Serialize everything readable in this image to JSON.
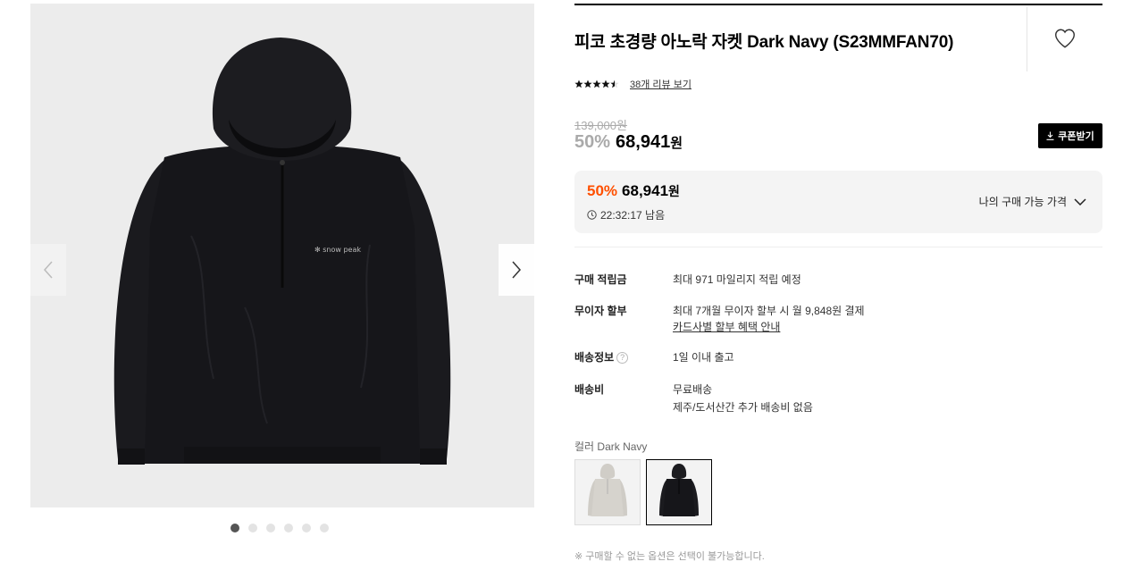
{
  "product": {
    "title": "피코 초경량 아노락 자켓 Dark Navy (S23MMFAN70)",
    "review_link": "38개 리뷰 보기",
    "rating_stars": 4.5
  },
  "pricing": {
    "original_price": "139,000원",
    "discount_rate": "50%",
    "sale_price": "68,941",
    "currency": "원",
    "coupon_button": "쿠폰받기"
  },
  "my_price": {
    "discount_rate": "50%",
    "price": "68,941",
    "currency": "원",
    "timer": "22:32:17 남음",
    "label": "나의 구매 가능 가격"
  },
  "specs": {
    "points_key": "구매 적립금",
    "points_value": "최대 971 마일리지 적립 예정",
    "installment_key": "무이자 할부",
    "installment_value": "최대 7개월 무이자 할부 시 월 9,848원 결제",
    "installment_link": "카드사별 할부 혜택 안내",
    "shipping_info_key": "배송정보",
    "shipping_info_value": "1일 이내 출고",
    "shipping_fee_key": "배송비",
    "shipping_fee_value": "무료배송",
    "shipping_fee_note": "제주/도서산간 추가 배송비 없음"
  },
  "options": {
    "color_label": "컬러 Dark Navy",
    "notice": "※ 구매할 수 없는 옵션은 선택이 불가능합니다."
  },
  "gallery": {
    "dot_count": 6,
    "active_index": 0
  },
  "colors": {
    "accent_orange": "#ff5000",
    "link_blue": "#1d5cd8",
    "jacket": "#16161a"
  }
}
